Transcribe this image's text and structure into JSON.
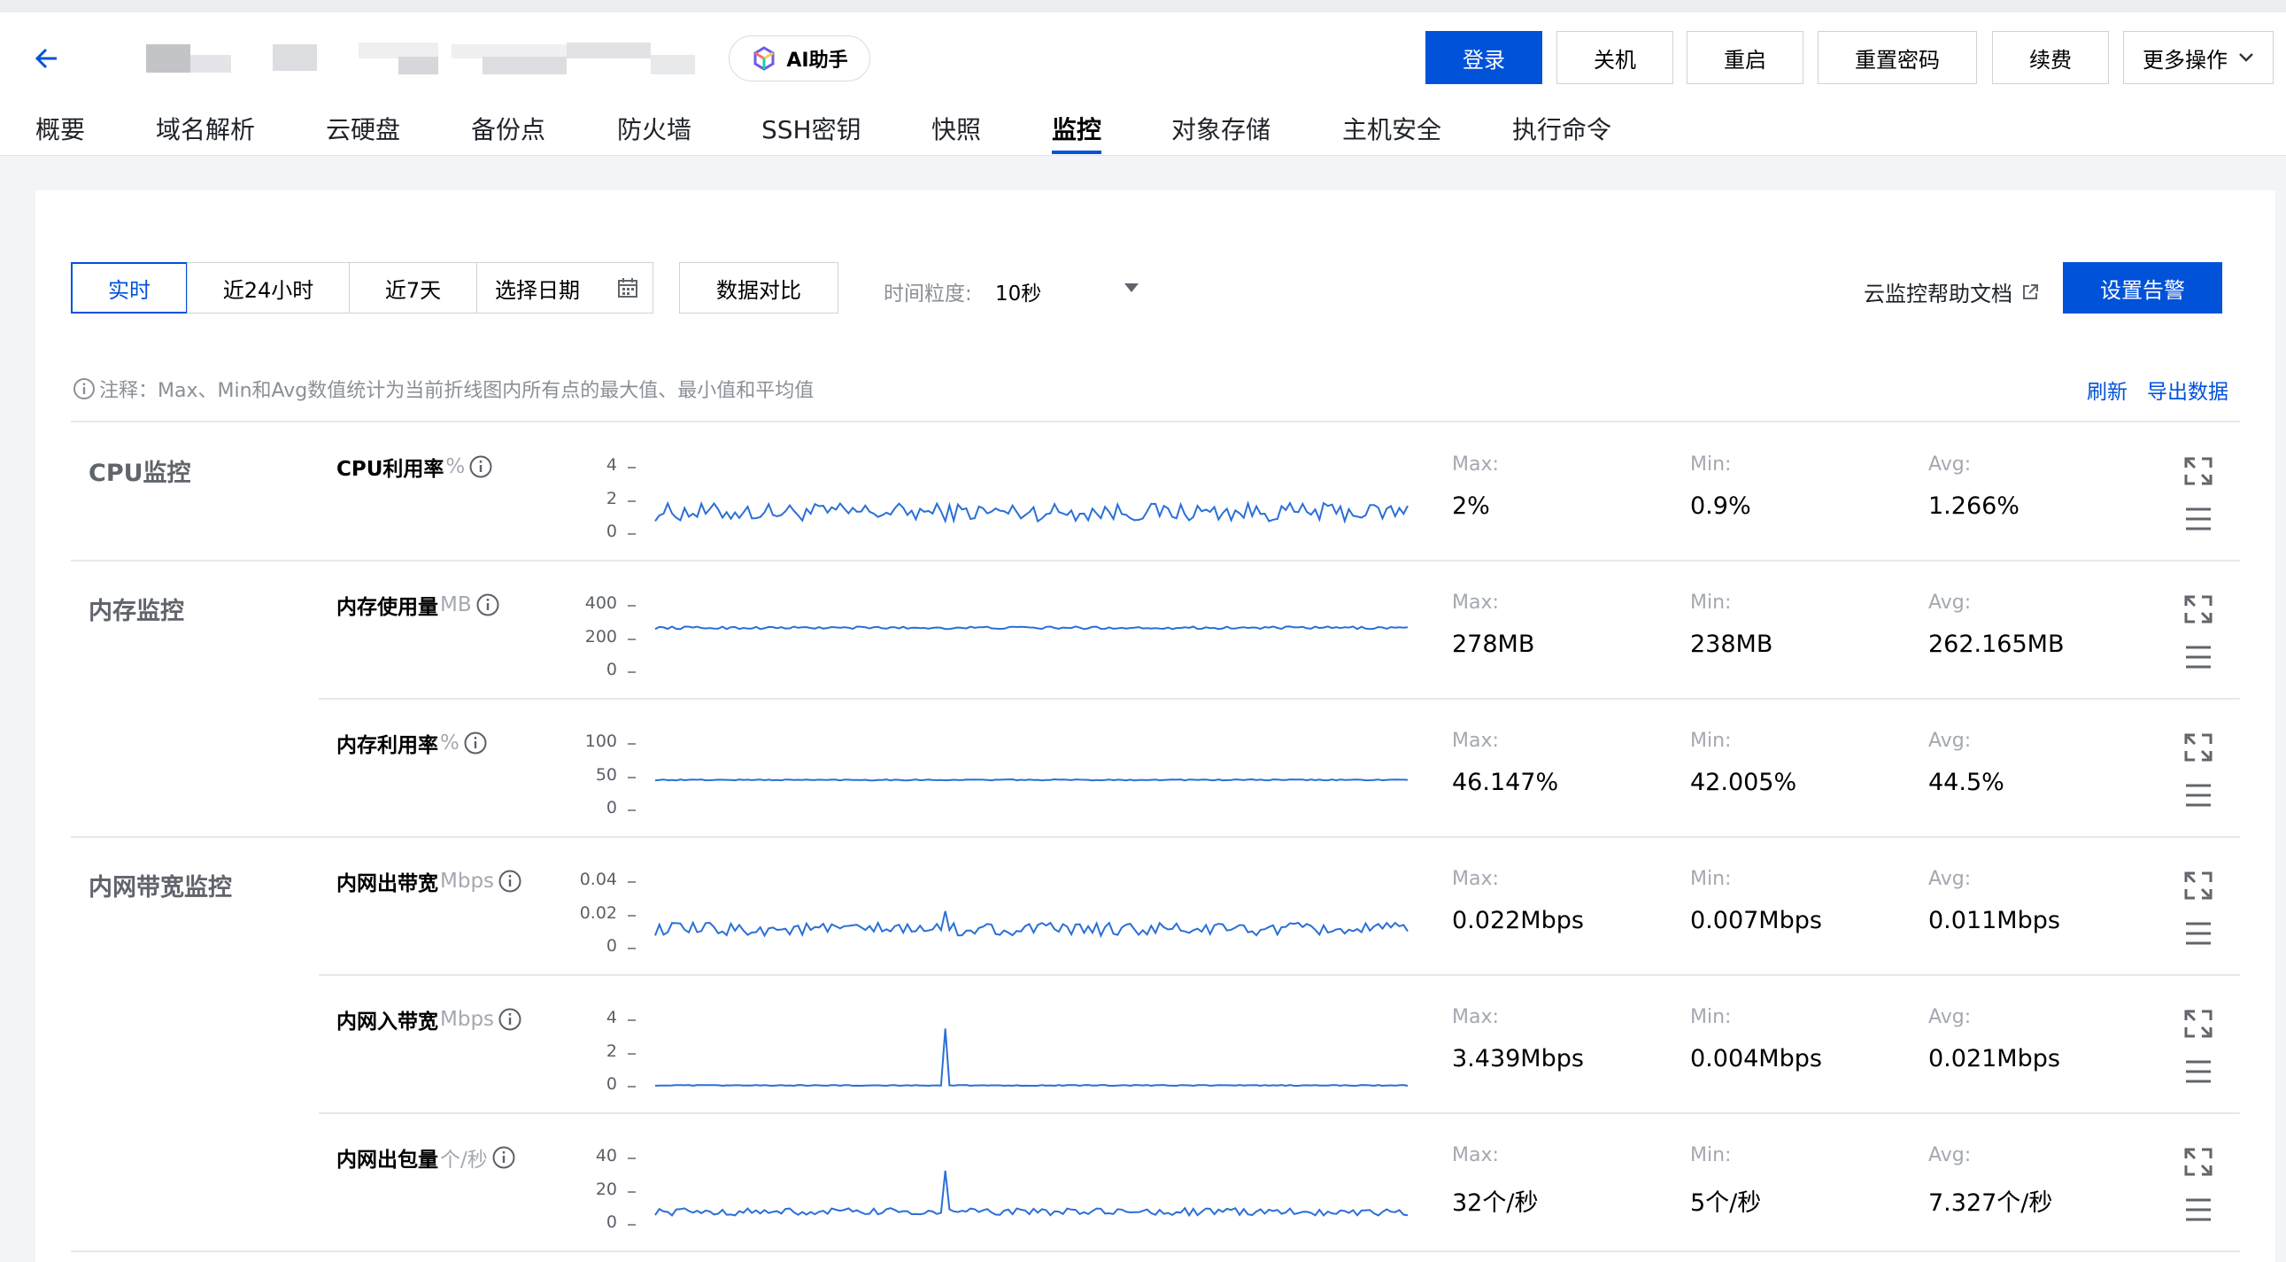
{
  "header": {
    "ai_label": "AI助手",
    "buttons": [
      "登录",
      "关机",
      "重启",
      "重置密码",
      "续费",
      "更多操作"
    ],
    "tabs": [
      "概要",
      "域名解析",
      "云硬盘",
      "备份点",
      "防火墙",
      "SSH密钥",
      "快照",
      "监控",
      "对象存储",
      "主机安全",
      "执行命令"
    ],
    "active_tab": "监控"
  },
  "toolbar": {
    "ranges": [
      "实时",
      "近24小时",
      "近7天"
    ],
    "date_label": "选择日期",
    "compare_label": "数据对比",
    "granularity_label": "时间粒度:",
    "granularity_value": "10秒",
    "help_label": "云监控帮助文档",
    "alarm_label": "设置告警"
  },
  "note": {
    "text": "注释：Max、Min和Avg数值统计为当前折线图内所有点的最大值、最小值和平均值",
    "refresh": "刷新",
    "export": "导出数据"
  },
  "stat_labels": {
    "max": "Max:",
    "min": "Min:",
    "avg": "Avg:"
  },
  "groups": [
    "CPU监控",
    "内存监控",
    "内网带宽监控"
  ],
  "colors": {
    "accent": "#0052d9",
    "line": "#2a6fd6"
  },
  "chart_data": [
    {
      "type": "line",
      "title": "CPU利用率",
      "unit": "%",
      "yticks": [
        "4",
        "2",
        "0"
      ],
      "ylim": [
        0,
        4
      ],
      "max": "2%",
      "min": "0.9%",
      "avg": "1.266%",
      "baseline": 1.266,
      "spread": 0.55
    },
    {
      "type": "line",
      "title": "内存使用量",
      "unit": "MB",
      "yticks": [
        "400",
        "200",
        "0"
      ],
      "ylim": [
        0,
        400
      ],
      "max": "278MB",
      "min": "238MB",
      "avg": "262.165MB",
      "baseline": 262,
      "spread": 8
    },
    {
      "type": "line",
      "title": "内存利用率",
      "unit": "%",
      "yticks": [
        "100",
        "50",
        "0"
      ],
      "ylim": [
        0,
        100
      ],
      "max": "46.147%",
      "min": "42.005%",
      "avg": "44.5%",
      "baseline": 44.5,
      "spread": 0.8
    },
    {
      "type": "line",
      "title": "内网出带宽",
      "unit": "Mbps",
      "yticks": [
        "0.04",
        "0.02",
        "0"
      ],
      "ylim": [
        0,
        0.04
      ],
      "max": "0.022Mbps",
      "min": "0.007Mbps",
      "avg": "0.011Mbps",
      "baseline": 0.011,
      "spread": 0.004,
      "spike_at": 0.385,
      "spike_value": 0.022
    },
    {
      "type": "line",
      "title": "内网入带宽",
      "unit": "Mbps",
      "yticks": [
        "4",
        "2",
        "0"
      ],
      "ylim": [
        0,
        4
      ],
      "max": "3.439Mbps",
      "min": "0.004Mbps",
      "avg": "0.021Mbps",
      "baseline": 0.02,
      "spread": 0.03,
      "spike_at": 0.385,
      "spike_value": 3.439
    },
    {
      "type": "line",
      "title": "内网出包量",
      "unit": "个/秒",
      "yticks": [
        "40",
        "20",
        "0"
      ],
      "ylim": [
        0,
        40
      ],
      "max": "32个/秒",
      "min": "5个/秒",
      "avg": "7.327个/秒",
      "baseline": 7.3,
      "spread": 2.2,
      "spike_at": 0.385,
      "spike_value": 32
    }
  ]
}
